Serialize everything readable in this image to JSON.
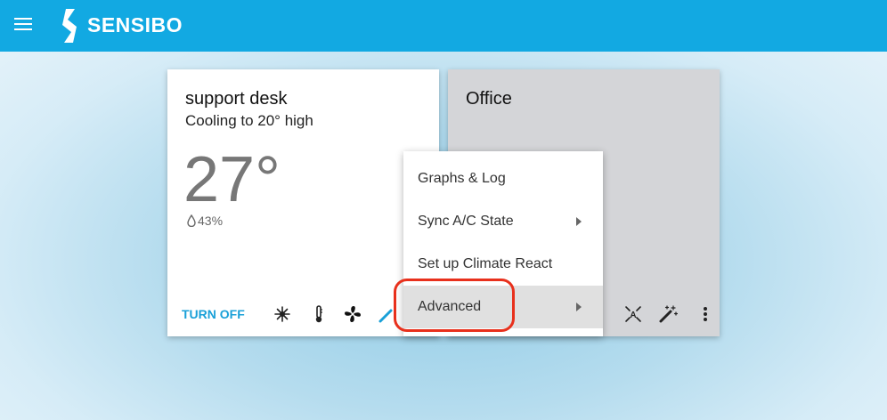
{
  "header": {
    "brand": "SENSIBO",
    "menu_icon": "menu-icon",
    "logo_icon": "sensibo-logo-icon"
  },
  "devices": [
    {
      "name": "support desk",
      "status": "Cooling to 20° high",
      "temperature": "27°",
      "humidity": "43%",
      "turn_off_label": "TURN OFF",
      "icons": [
        "cool-mode-icon",
        "thermometer-icon",
        "fan-icon",
        "magic-wand-icon"
      ]
    },
    {
      "name": "Office",
      "icons": [
        "auto-mode-icon",
        "magic-wand-icon",
        "more-vert-icon"
      ]
    }
  ],
  "context_menu": {
    "items": [
      {
        "label": "Graphs & Log",
        "has_submenu": false
      },
      {
        "label": "Sync A/C State",
        "has_submenu": true
      },
      {
        "label": "Set up Climate React",
        "has_submenu": false
      },
      {
        "label": "Advanced",
        "has_submenu": true,
        "active": true
      }
    ]
  },
  "colors": {
    "header": "#12a9e2",
    "accent": "#1aa0d8",
    "highlight": "#e8301c"
  }
}
